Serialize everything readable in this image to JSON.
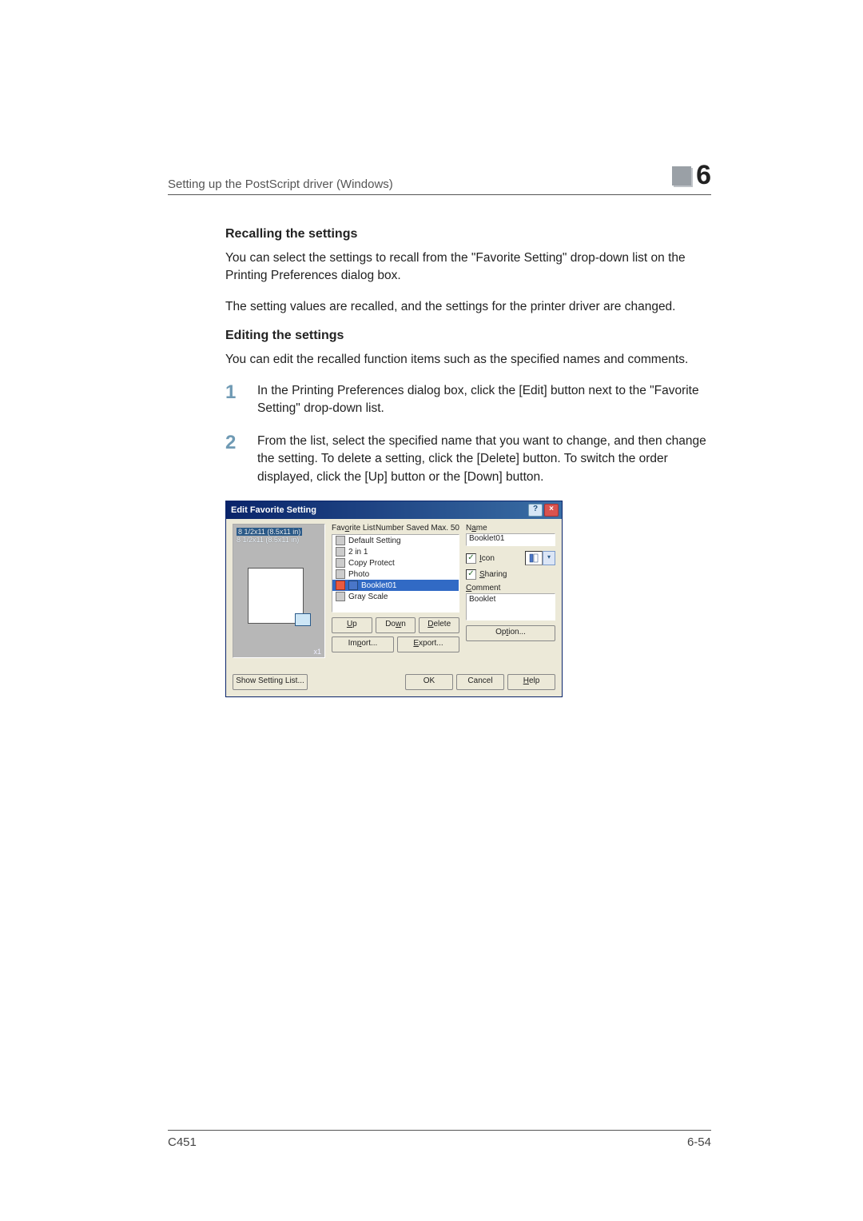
{
  "header": {
    "title": "Setting up the PostScript driver (Windows)",
    "chapter": "6"
  },
  "sections": {
    "s1": {
      "title": "Recalling the settings",
      "p1": "You can select the settings to recall from the \"Favorite Setting\" drop-down list on the Printing Preferences dialog box.",
      "p2": "The setting values are recalled, and the settings for the printer driver are changed."
    },
    "s2": {
      "title": "Editing the settings",
      "p1": "You can edit the recalled function items such as the specified names and comments.",
      "steps": {
        "1": "In the Printing Preferences dialog box, click the [Edit] button next to the \"Favorite Setting\" drop-down list.",
        "2": "From the list, select the specified name that you want to change, and then change the setting. To delete a setting, click the [Delete] button. To switch the order displayed, click the [Up] button or the [Down] button."
      }
    }
  },
  "dialog": {
    "title": "Edit Favorite Setting",
    "help_btn": "?",
    "close_btn": "×",
    "preview": {
      "line1": "8 1/2x11 (8.5x11 in)",
      "line2": "8 1/2x11 (8.5x11 in)",
      "zoom": "x1"
    },
    "favorite_label": "Favorite List",
    "number_saved": "Number Saved Max. 50",
    "items": [
      {
        "label": "Default Setting"
      },
      {
        "label": "2 in 1"
      },
      {
        "label": "Copy Protect"
      },
      {
        "label": "Photo"
      },
      {
        "label": "Booklet01",
        "selected": true
      },
      {
        "label": "Gray Scale"
      }
    ],
    "buttons": {
      "up": "Up",
      "down": "Down",
      "delete": "Delete",
      "import": "Import...",
      "export": "Export...",
      "option": "Option...",
      "show_setting": "Show Setting List...",
      "ok": "OK",
      "cancel": "Cancel",
      "help": "Help"
    },
    "fields": {
      "name_label": "Name",
      "name_value": "Booklet01",
      "icon_label": "Icon",
      "sharing_label": "Sharing",
      "comment_label": "Comment",
      "comment_value": "Booklet"
    }
  },
  "footer": {
    "left": "C451",
    "right": "6-54"
  }
}
